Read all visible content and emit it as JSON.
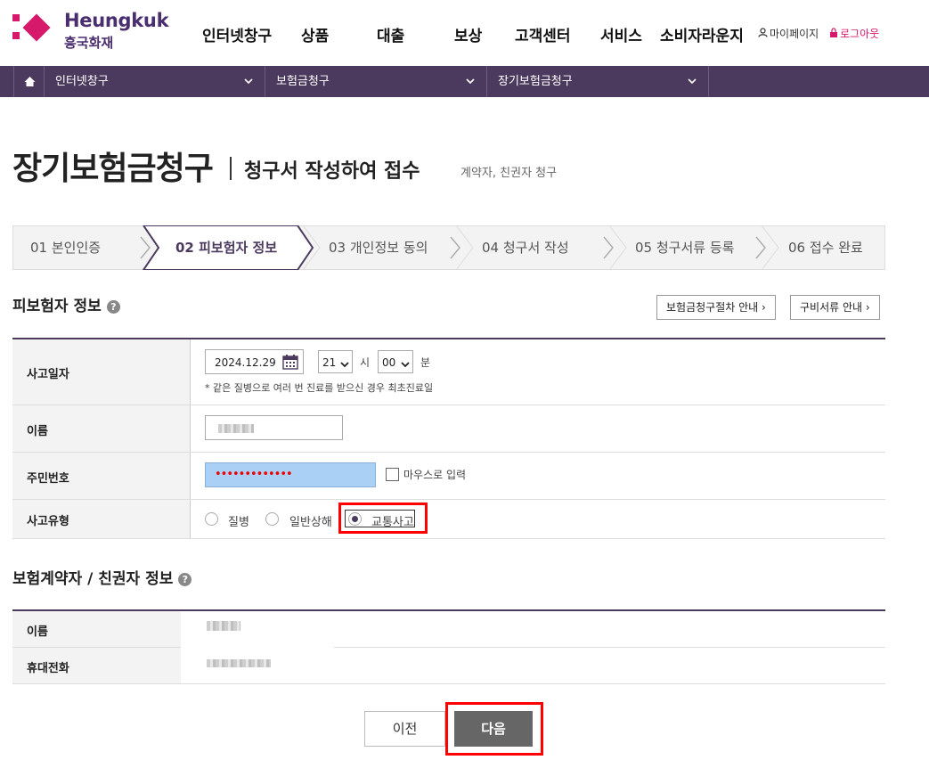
{
  "brand": {
    "name_en": "Heungkuk",
    "name_ko": "흥국화재"
  },
  "gnb": [
    "인터넷창구",
    "상품",
    "대출",
    "보상",
    "고객센터",
    "서비스",
    "소비자라운지"
  ],
  "util": {
    "mypage": "마이페이지",
    "logout": "로그아웃"
  },
  "breadcrumb": [
    {
      "label": "인터넷창구"
    },
    {
      "label": "보험금청구"
    },
    {
      "label": "장기보험금청구"
    }
  ],
  "title": {
    "main": "장기보험금청구",
    "sub": "청구서 작성하여 접수",
    "note": "계약자, 친권자 청구"
  },
  "steps": [
    {
      "label": "01  본인인증",
      "active": false
    },
    {
      "label": "02  피보험자 정보",
      "active": true
    },
    {
      "label": "03  개인정보 동의",
      "active": false
    },
    {
      "label": "04  청구서 작성",
      "active": false
    },
    {
      "label": "05  청구서류 등록",
      "active": false
    },
    {
      "label": "06  접수 완료",
      "active": false
    }
  ],
  "insured_section": {
    "title": "피보험자 정보",
    "guide_buttons": [
      "보험금청구절차 안내 ›",
      "구비서류 안내 ›"
    ],
    "fields": {
      "accident_date": {
        "label": "사고일자",
        "value": "2024.12.29",
        "hour": "21",
        "hour_unit": "시",
        "minute": "00",
        "minute_unit": "분",
        "note": "* 같은 질병으로 여러 번 진료를 받으신 경우 최초진료일"
      },
      "name": {
        "label": "이름"
      },
      "rrn": {
        "label": "주민번호",
        "masked": "•••••••••••••",
        "mouse_input": "마우스로 입력"
      },
      "accident_type": {
        "label": "사고유형",
        "options": [
          "질병",
          "일반상해",
          "교통사고"
        ],
        "selected": "교통사고"
      }
    }
  },
  "holder_section": {
    "title": "보험계약자 / 친권자 정보",
    "fields": {
      "name": {
        "label": "이름"
      },
      "phone": {
        "label": "휴대전화"
      }
    }
  },
  "buttons": {
    "prev": "이전",
    "next": "다음"
  },
  "colors": {
    "brand_purple": "#4c3a5e",
    "brand_pink": "#d6196b",
    "highlight": "#ff0000"
  }
}
